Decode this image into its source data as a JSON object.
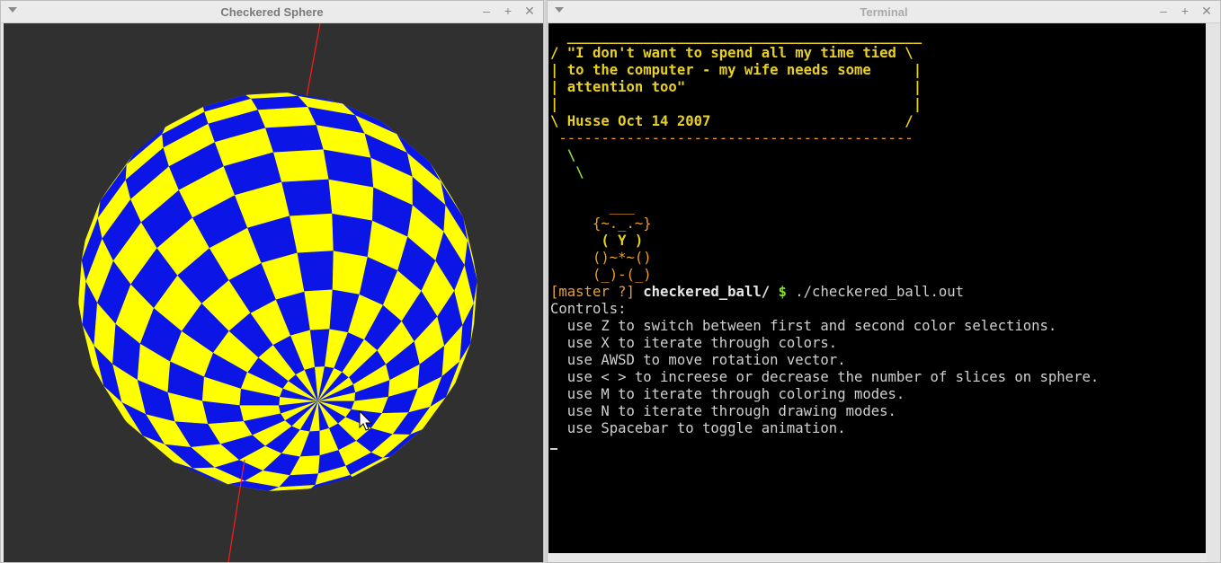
{
  "left_window": {
    "title": "Checkered Sphere",
    "buttons": {
      "minimize": "–",
      "maximize": "+",
      "close": "✕"
    },
    "scene": {
      "background": "#303030",
      "checker_colors": [
        "#0b16e6",
        "#ffff00"
      ],
      "axis_color": "#ff1b1b"
    }
  },
  "right_window": {
    "title": "Terminal",
    "buttons": {
      "minimize": "–",
      "maximize": "+",
      "close": "✕"
    }
  },
  "terminal": {
    "quote_top": "  __________________________________________",
    "quote_l1": "/ \"I don't want to spend all my time tied \\",
    "quote_l2": "| to the computer - my wife needs some     |",
    "quote_l3": "| attention too\"                           |",
    "quote_l4": "|                                          |",
    "quote_l5": "\\ Husse Oct 14 2007                       /",
    "quote_bottom": " ------------------------------------------",
    "tail1": "  \\",
    "tail2": "   \\",
    "blank": "",
    "owl1": "       ___",
    "owl2": "     {~._.~}",
    "owl3": "      ( Y )",
    "owl4": "     ()~*~()",
    "owl5": "     (_)-(_)",
    "prompt_branch": "[master ?]",
    "prompt_dir": " checkered_ball/",
    "prompt_dollar": " $ ",
    "prompt_cmd": "./checkered_ball.out",
    "controls_header": "Controls:",
    "controls": [
      "  use Z to switch between first and second color selections.",
      "  use X to iterate through colors.",
      "  use AWSD to move rotation vector.",
      "  use < > to increese or decrease the number of slices on sphere.",
      "  use M to iterate through coloring modes.",
      "  use N to iterate through drawing modes.",
      "  use Spacebar to toggle animation."
    ]
  }
}
